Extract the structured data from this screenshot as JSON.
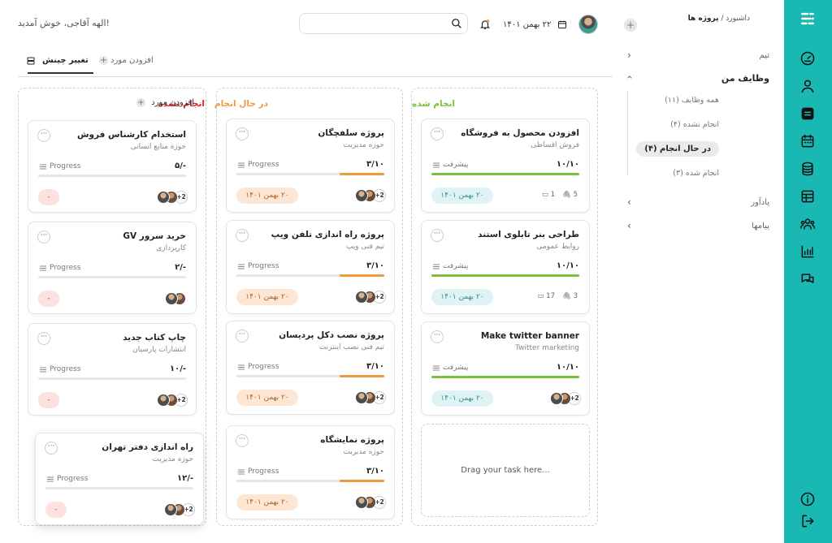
{
  "header": {
    "welcome": "الهه آقاجی، خوش آمدید!",
    "date": "۲۲ بهمن ۱۴۰۱",
    "search_placeholder": ""
  },
  "breadcrumb": {
    "parent": "داشبورد",
    "sep": " / ",
    "current": "پروژه ها"
  },
  "sidebar": {
    "team": "تیم",
    "my_tasks": "وظایف من",
    "sub": [
      "همه وظایف (۱۱)",
      "انجام نشده (۴)",
      "در حال انجام (۴)",
      "انجام شده (۳)"
    ],
    "reminders": "یادآور",
    "messages": "پیامها"
  },
  "tabs": {
    "change_layout": "تغییر چینش",
    "add_item": "افزودن مورد"
  },
  "columns": {
    "todo": {
      "title": "انجام نشده",
      "add_label": "افزودن مورد"
    },
    "doing": {
      "title": "در حال انجام"
    },
    "done": {
      "title": "انجام شده",
      "drop_text": "Drag your task here..."
    }
  },
  "colors": {
    "todo": "#e0262c",
    "doing": "#f09a3e",
    "done": "#7cc13a",
    "rail": "#19b8b3"
  },
  "cards": {
    "todo": [
      {
        "title": "استخدام کارشناس فروش",
        "sub": "حوزه منابع انسانی",
        "progress_label": "Progress",
        "progress": "۵/-",
        "fill": 0,
        "pill": "-",
        "extra": "+2"
      },
      {
        "title": "خرید سرور GV",
        "sub": "کارپردازی",
        "progress_label": "Progress",
        "progress": "۲/-",
        "fill": 0,
        "pill": "-",
        "extra": ""
      },
      {
        "title": "چاپ کتاب جدید",
        "sub": "انتشارات پارسیان",
        "progress_label": "Progress",
        "progress": "۱۰/-",
        "fill": 0,
        "pill": "-",
        "extra": "+2"
      },
      {
        "title": "راه اندازی دفتر تهران",
        "sub": "حوزه مدیریت",
        "progress_label": "Progress",
        "progress": "۱۲/-",
        "fill": 0,
        "pill": "-",
        "extra": "+2"
      }
    ],
    "doing": [
      {
        "title": "پروژه سلفچگان",
        "sub": "حوزه مدیریت",
        "progress_label": "Progress",
        "progress": "۳/۱۰",
        "fill": 0.3,
        "pill": "۲۰ بهمن ۱۴۰۱",
        "extra": "+2"
      },
      {
        "title": "پروژه راه اندازی تلفن ویپ",
        "sub": "تیم فنی ویپ",
        "progress_label": "Progress",
        "progress": "۳/۱۰",
        "fill": 0.3,
        "pill": "۲۰ بهمن ۱۴۰۱",
        "extra": "+2"
      },
      {
        "title": "پروژه نصب دکل پردیسان",
        "sub": "تیم فنی نصب اینترنت",
        "progress_label": "Progress",
        "progress": "۳/۱۰",
        "fill": 0.3,
        "pill": "۲۰ بهمن ۱۴۰۱",
        "extra": "+2"
      },
      {
        "title": "پروژه نمایشگاه",
        "sub": "حوزه مدیریت",
        "progress_label": "Progress",
        "progress": "۳/۱۰",
        "fill": 0.3,
        "pill": "۲۰ بهمن ۱۴۰۱",
        "extra": "+2"
      }
    ],
    "done": [
      {
        "title": "افزودن محصول به فروشگاه",
        "sub": "فروش اقساطی",
        "progress_label": "پیشرفت",
        "progress": "۱۰/۱۰",
        "fill": 1,
        "pill": "۲۰ بهمن ۱۴۰۱",
        "comments": "1",
        "attachments": "5"
      },
      {
        "title": "طراحی بنر تابلوی استند",
        "sub": "روابط عمومی",
        "progress_label": "پیشرفت",
        "progress": "۱۰/۱۰",
        "fill": 1,
        "pill": "۲۰ بهمن ۱۴۰۱",
        "comments": "17",
        "attachments": "3"
      },
      {
        "title": "Make twitter banner",
        "sub": "Twitter marketing",
        "progress_label": "پیشرفت",
        "progress": "۱۰/۱۰",
        "fill": 1,
        "pill": "۲۰ بهمن ۱۴۰۱",
        "extra": "+2"
      }
    ]
  },
  "icons": [
    "menu-icon",
    "gauge-icon",
    "user-icon",
    "tasks-icon",
    "calendar-icon",
    "coins-icon",
    "table-icon",
    "team-icon",
    "chart-icon",
    "chat-icon",
    "info-icon",
    "logout-icon",
    "search-icon",
    "bell-icon",
    "more-icon",
    "comment-icon",
    "paperclip-icon"
  ]
}
